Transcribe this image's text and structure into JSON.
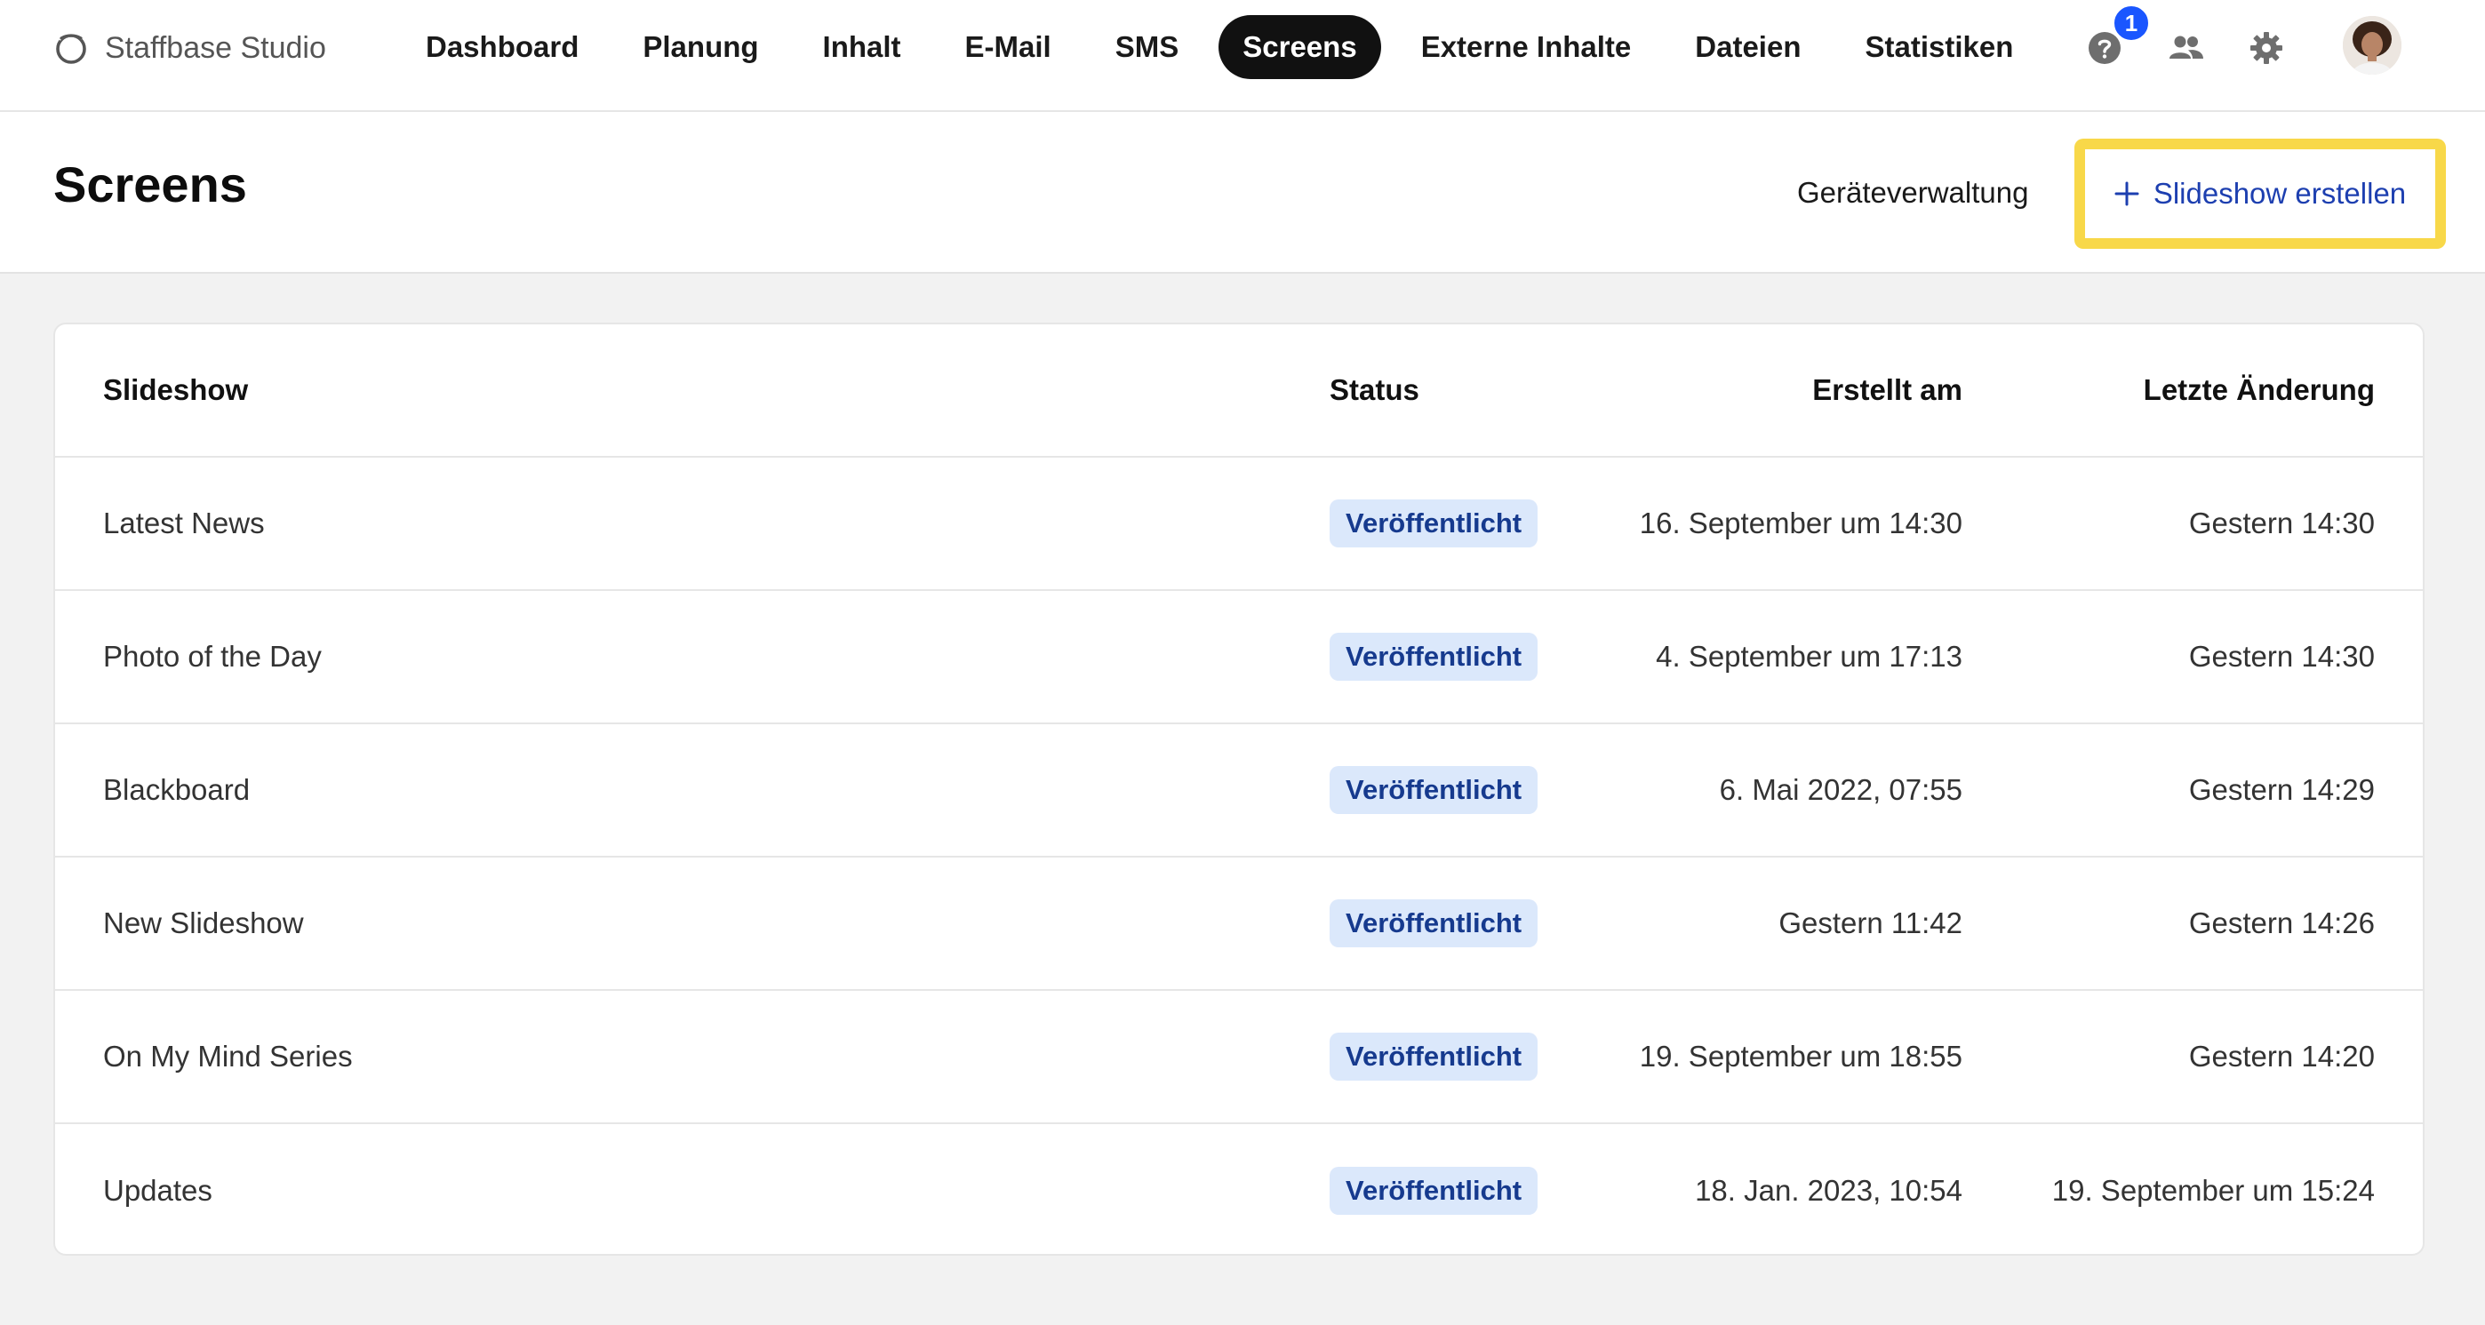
{
  "brand": {
    "name": "Staffbase Studio",
    "logo_icon": "staffbase-logo-icon"
  },
  "nav": {
    "items": [
      {
        "label": "Dashboard"
      },
      {
        "label": "Planung"
      },
      {
        "label": "Inhalt"
      },
      {
        "label": "E-Mail"
      },
      {
        "label": "SMS"
      },
      {
        "label": "Screens",
        "active": true
      },
      {
        "label": "Externe Inhalte"
      },
      {
        "label": "Dateien"
      },
      {
        "label": "Statistiken"
      }
    ],
    "help_badge_count": "1",
    "icons": [
      "help-icon",
      "people-icon",
      "gear-icon",
      "avatar"
    ]
  },
  "header": {
    "title": "Screens",
    "device_management_label": "Geräteverwaltung",
    "create_label": "Slideshow erstellen",
    "highlight_color": "#f8d849"
  },
  "table": {
    "columns": {
      "slideshow": "Slideshow",
      "status": "Status",
      "created": "Erstellt am",
      "changed": "Letzte Änderung"
    },
    "rows": [
      {
        "name": "Latest News",
        "status": "Veröffentlicht",
        "created": "16. September um 14:30",
        "changed": "Gestern 14:30"
      },
      {
        "name": "Photo of the Day",
        "status": "Veröffentlicht",
        "created": "4. September um 17:13",
        "changed": "Gestern 14:30"
      },
      {
        "name": "Blackboard",
        "status": "Veröffentlicht",
        "created": "6. Mai 2022, 07:55",
        "changed": "Gestern 14:29"
      },
      {
        "name": "New Slideshow",
        "status": "Veröffentlicht",
        "created": "Gestern 11:42",
        "changed": "Gestern 14:26"
      },
      {
        "name": "On My Mind Series",
        "status": "Veröffentlicht",
        "created": "19. September um 18:55",
        "changed": "Gestern 14:20"
      },
      {
        "name": "Updates",
        "status": "Veröffentlicht",
        "created": "18. Jan. 2023, 10:54",
        "changed": "19. September um 15:24"
      }
    ]
  },
  "colors": {
    "active_nav_bg": "#111111",
    "badge_bg": "#dbe8fb",
    "badge_text": "#163a8e",
    "link_blue": "#1d3fb0",
    "notification_blue": "#1a56ff"
  }
}
